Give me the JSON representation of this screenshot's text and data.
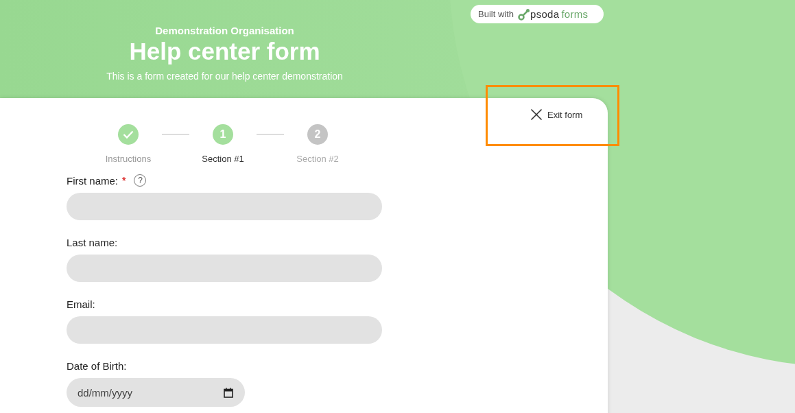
{
  "header": {
    "organisation": "Demonstration Organisation",
    "title": "Help center form",
    "subtitle": "This is a form created for our help center demonstration"
  },
  "badge": {
    "prefix": "Built with",
    "brand": "psoda",
    "brand_suffix": "forms"
  },
  "exit": {
    "label": "Exit form",
    "highlighted": true
  },
  "steps": [
    {
      "label": "Instructions",
      "kind": "done"
    },
    {
      "label": "Section #1",
      "number": "1",
      "kind": "current"
    },
    {
      "label": "Section #2",
      "number": "2",
      "kind": "upcoming"
    }
  ],
  "fields": [
    {
      "label": "First name:",
      "required_mark": "*",
      "help": "?",
      "kind": "text"
    },
    {
      "label": "Last name:",
      "kind": "text"
    },
    {
      "label": "Email:",
      "kind": "text"
    },
    {
      "label": "Date of Birth:",
      "kind": "date",
      "placeholder": "dd/mm/yyyy"
    }
  ]
}
